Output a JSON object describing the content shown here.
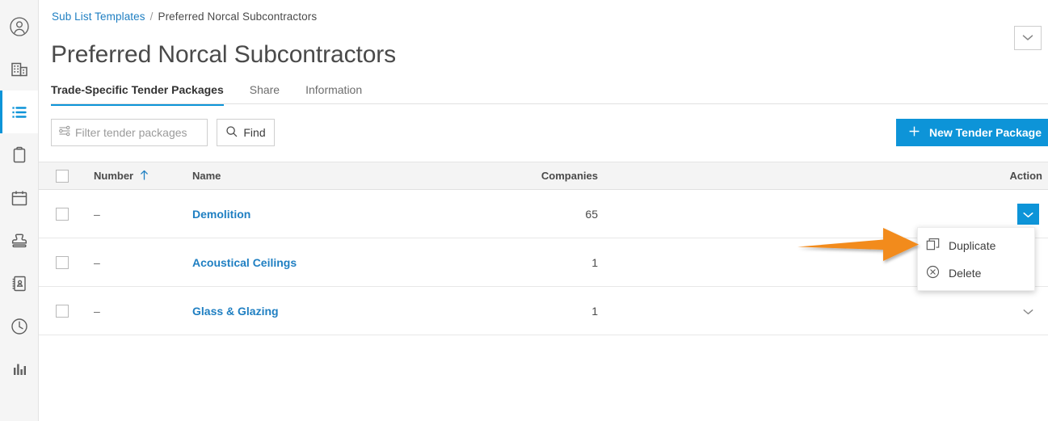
{
  "sidebar": {
    "items": [
      {
        "name": "account-icon",
        "label": "Account",
        "active": false
      },
      {
        "name": "company-icon",
        "label": "Company",
        "active": false
      },
      {
        "name": "list-icon",
        "label": "Lists",
        "active": true
      },
      {
        "name": "clipboard-icon",
        "label": "Clipboard",
        "active": false
      },
      {
        "name": "calendar-icon",
        "label": "Calendar",
        "active": false
      },
      {
        "name": "stamp-icon",
        "label": "Stamp",
        "active": false
      },
      {
        "name": "address-book-icon",
        "label": "Address Book",
        "active": false
      },
      {
        "name": "clock-icon",
        "label": "History",
        "active": false
      },
      {
        "name": "bar-chart-icon",
        "label": "Reports",
        "active": false
      }
    ]
  },
  "header": {
    "breadcrumb_parent": "Sub List Templates",
    "breadcrumb_separator": "/",
    "breadcrumb_current": "Preferred Norcal Subcontractors",
    "title": "Preferred Norcal Subcontractors",
    "chevron_icon": "chevron-down-icon"
  },
  "tabs": [
    {
      "label": "Trade-Specific Tender Packages",
      "active": true
    },
    {
      "label": "Share",
      "active": false
    },
    {
      "label": "Information",
      "active": false
    }
  ],
  "toolbar": {
    "filter_placeholder": "Filter tender packages",
    "filter_value": "",
    "filter_icon": "filter-sliders-icon",
    "find_label": "Find",
    "find_icon": "search-icon",
    "new_package_label": "New Tender Package",
    "new_package_icon": "plus-icon"
  },
  "table": {
    "columns": [
      {
        "key": "checkbox",
        "label": ""
      },
      {
        "key": "number",
        "label": "Number",
        "sort": "asc",
        "sort_icon": "arrow-up-icon"
      },
      {
        "key": "name",
        "label": "Name"
      },
      {
        "key": "companies",
        "label": "Companies"
      },
      {
        "key": "action",
        "label": "Action"
      }
    ],
    "rows": [
      {
        "checked": false,
        "number": "–",
        "name": "Demolition",
        "companies": "65",
        "chevron": "blue"
      },
      {
        "checked": false,
        "number": "–",
        "name": "Acoustical Ceilings",
        "companies": "1",
        "chevron": "hidden"
      },
      {
        "checked": false,
        "number": "–",
        "name": "Glass & Glazing",
        "companies": "1",
        "chevron": "plain"
      }
    ]
  },
  "context_menu": {
    "open": true,
    "items": [
      {
        "label": "Duplicate",
        "icon": "duplicate-icon"
      },
      {
        "label": "Delete",
        "icon": "delete-circle-x-icon"
      }
    ]
  },
  "annotation": {
    "arrow_icon": "orange-arrow-right",
    "arrow_color": "#F28B1E"
  },
  "colors": {
    "accent_blue": "#0d94d8",
    "link_blue": "#1f7fc2",
    "sidebar_bg": "#f5f5f5",
    "header_row_bg": "#f4f4f4",
    "text_primary": "#4a4a4a",
    "annotation_orange": "#F28B1E"
  }
}
